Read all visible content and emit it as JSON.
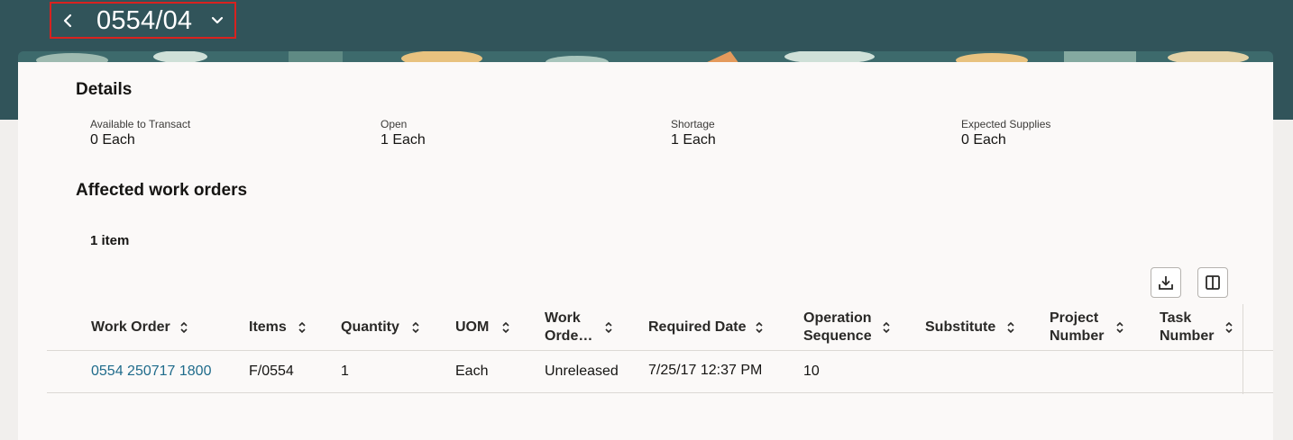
{
  "header": {
    "title": "0554/04"
  },
  "details": {
    "heading": "Details",
    "fields": [
      {
        "label": "Available to Transact",
        "value": "0 Each"
      },
      {
        "label": "Open",
        "value": "1 Each"
      },
      {
        "label": "Shortage",
        "value": "1 Each"
      },
      {
        "label": "Expected Supplies",
        "value": "0 Each"
      }
    ]
  },
  "affected": {
    "heading": "Affected work orders",
    "count": "1 item",
    "columns": [
      {
        "line1": "Work Order",
        "line2": ""
      },
      {
        "line1": "Items",
        "line2": ""
      },
      {
        "line1": "Quantity",
        "line2": ""
      },
      {
        "line1": "UOM",
        "line2": ""
      },
      {
        "line1": "Work",
        "line2": "Orde…"
      },
      {
        "line1": "Required Date",
        "line2": ""
      },
      {
        "line1": "Operation",
        "line2": "Sequence"
      },
      {
        "line1": "Substitute",
        "line2": ""
      },
      {
        "line1": "Project",
        "line2": "Number"
      },
      {
        "line1": "Task",
        "line2": "Number"
      }
    ],
    "rows": [
      [
        "0554 250717 1800",
        "F/0554",
        "1",
        "Each",
        "Unreleased",
        "7/25/17 12:37 PM",
        "10",
        "",
        "",
        ""
      ]
    ]
  },
  "colors": {
    "header_bg": "#31545a",
    "link": "#1f6b8b",
    "highlight_border": "#d9221f"
  }
}
